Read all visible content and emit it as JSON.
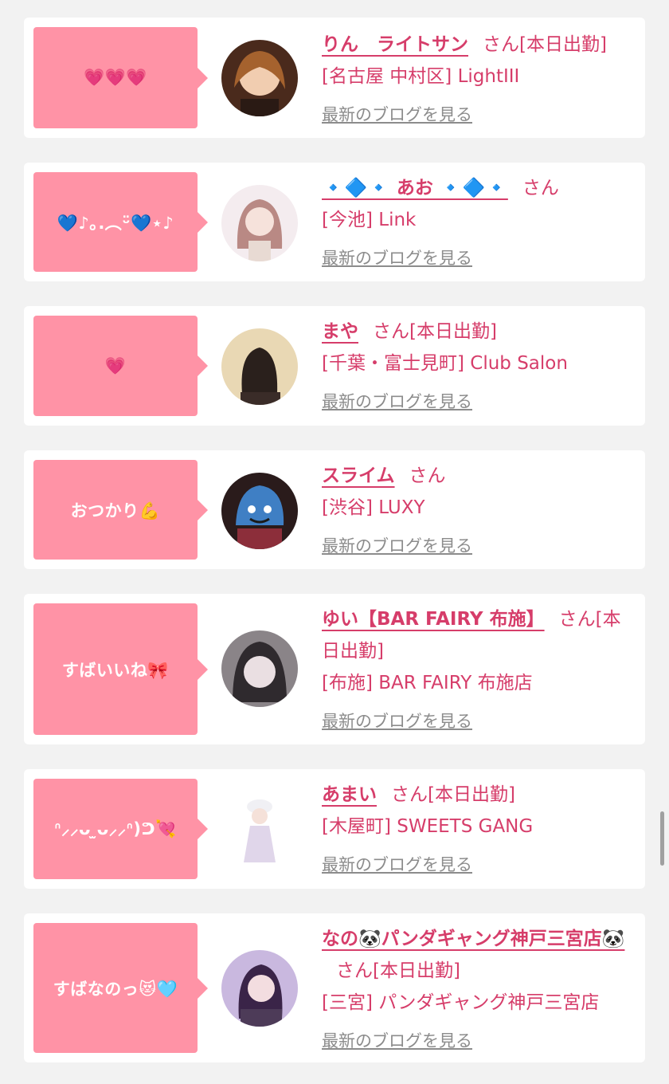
{
  "cards": [
    {
      "bubble": "💗💗💗",
      "name": "りん　ライトサン",
      "suffix": "さん[本日出勤]",
      "shop": "[名古屋 中村区] LightIII",
      "blog_link": "最新のブログを見る"
    },
    {
      "bubble": "💙♪｡.︵ᵕ̈💙⋆♪",
      "name": "🔹🔷🔹 あお 🔹🔷🔹",
      "suffix": "さん",
      "shop": "[今池] Link",
      "blog_link": "最新のブログを見る"
    },
    {
      "bubble": "💗",
      "name": "まや",
      "suffix": "さん[本日出勤]",
      "shop": "[千葉・富士見町] Club Salon",
      "blog_link": "最新のブログを見る"
    },
    {
      "bubble": "おつかり💪",
      "name": "スライム",
      "suffix": "さん",
      "shop": "[渋谷] LUXY",
      "blog_link": "最新のブログを見る"
    },
    {
      "bubble": "すばいいね🎀",
      "name": "ゆい【BAR FAIRY 布施】",
      "suffix": "さん[本日出勤]",
      "shop": "[布施] BAR FAIRY 布施店",
      "blog_link": "最新のブログを見る"
    },
    {
      "bubble": "ᐢ⸝⸝ᴗ ̫ᴗ⸝⸝ᐢ)ᕤ💘",
      "name": "あまい",
      "suffix": "さん[本日出勤]",
      "shop": "[木屋町] SWEETS GANG",
      "blog_link": "最新のブログを見る"
    },
    {
      "bubble": "すばなのっ😻🩵",
      "name": "なの🐼パンダギャング神戸三宮店🐼",
      "suffix": "さん[本日出勤]",
      "shop": "[三宮] パンダギャング神戸三宮店",
      "blog_link": "最新のブログを見る"
    }
  ]
}
